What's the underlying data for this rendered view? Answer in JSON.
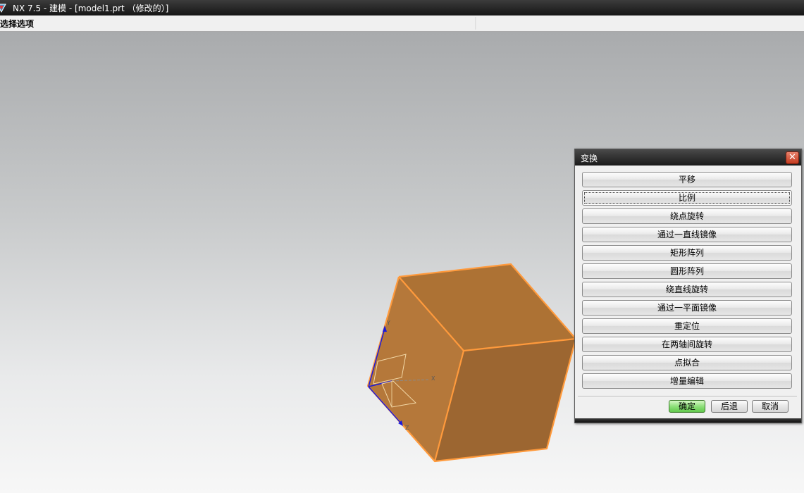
{
  "window": {
    "title": "NX 7.5 - 建模 - [model1.prt （修改的）]",
    "icon": "nx-logo-icon"
  },
  "status": {
    "prompt": "选择选项"
  },
  "viewport": {
    "background_top": "#a9abad",
    "background_bottom": "#f7f7f7",
    "cube_color": "#b0763a",
    "edge_color": "#ff9a3c",
    "axis_labels": {
      "x": "X",
      "y": "Y",
      "z": "Z"
    }
  },
  "dialog": {
    "title": "变换",
    "close_icon": "close-icon",
    "options": [
      "平移",
      "比例",
      "绕点旋转",
      "通过一直线镜像",
      "矩形阵列",
      "圆形阵列",
      "绕直线旋转",
      "通过一平面镜像",
      "重定位",
      "在两轴间旋转",
      "点拟合",
      "增量编辑"
    ],
    "focused_option": "比例",
    "ok_label": "确定",
    "back_label": "后退",
    "cancel_label": "取消"
  }
}
